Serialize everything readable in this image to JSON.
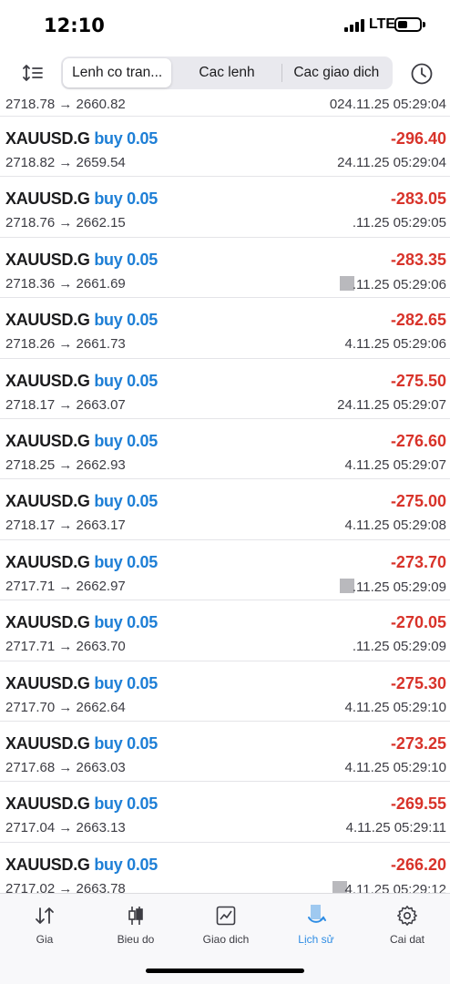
{
  "status": {
    "time": "12:10",
    "network": "LTE"
  },
  "toolbar": {
    "tabs": [
      {
        "label": "Lenh co tran..."
      },
      {
        "label": "Cac lenh"
      },
      {
        "label": "Cac giao dich"
      }
    ],
    "active_tab": 0
  },
  "first_row": {
    "prices": "2718.78 → 2660.82",
    "time": "024.11.25 05:29:04"
  },
  "trades": [
    {
      "symbol": "XAUUSD.G",
      "side": "buy 0.05",
      "profit": "-296.40",
      "prices": "2718.82 → 2659.54",
      "time": "24.11.25 05:29:04"
    },
    {
      "symbol": "XAUUSD.G",
      "side": "buy 0.05",
      "profit": "-283.05",
      "prices": "2718.76 → 2662.15",
      "time": ".11.25 05:29:05"
    },
    {
      "symbol": "XAUUSD.G",
      "side": "buy 0.05",
      "profit": "-283.35",
      "prices": "2718.36 → 2661.69",
      "time": ".11.25 05:29:06"
    },
    {
      "symbol": "XAUUSD.G",
      "side": "buy 0.05",
      "profit": "-282.65",
      "prices": "2718.26 → 2661.73",
      "time": "4.11.25 05:29:06"
    },
    {
      "symbol": "XAUUSD.G",
      "side": "buy 0.05",
      "profit": "-275.50",
      "prices": "2718.17 → 2663.07",
      "time": "24.11.25 05:29:07"
    },
    {
      "symbol": "XAUUSD.G",
      "side": "buy 0.05",
      "profit": "-276.60",
      "prices": "2718.25 → 2662.93",
      "time": "4.11.25 05:29:07"
    },
    {
      "symbol": "XAUUSD.G",
      "side": "buy 0.05",
      "profit": "-275.00",
      "prices": "2718.17 → 2663.17",
      "time": "4.11.25 05:29:08"
    },
    {
      "symbol": "XAUUSD.G",
      "side": "buy 0.05",
      "profit": "-273.70",
      "prices": "2717.71 → 2662.97",
      "time": ".11.25 05:29:09"
    },
    {
      "symbol": "XAUUSD.G",
      "side": "buy 0.05",
      "profit": "-270.05",
      "prices": "2717.71 → 2663.70",
      "time": ".11.25 05:29:09"
    },
    {
      "symbol": "XAUUSD.G",
      "side": "buy 0.05",
      "profit": "-275.30",
      "prices": "2717.70 → 2662.64",
      "time": "4.11.25 05:29:10"
    },
    {
      "symbol": "XAUUSD.G",
      "side": "buy 0.05",
      "profit": "-273.25",
      "prices": "2717.68 → 2663.03",
      "time": "4.11.25 05:29:10"
    },
    {
      "symbol": "XAUUSD.G",
      "side": "buy 0.05",
      "profit": "-269.55",
      "prices": "2717.04 → 2663.13",
      "time": "4.11.25 05:29:11"
    },
    {
      "symbol": "XAUUSD.G",
      "side": "buy 0.05",
      "profit": "-266.20",
      "prices": "2717.02 → 2663.78",
      "time": "4.11.25 05:29:12"
    }
  ],
  "blurred_rows": [
    2,
    7,
    12
  ],
  "tabbar": {
    "items": [
      {
        "label": "Gia",
        "icon": "quotes-icon"
      },
      {
        "label": "Bieu do",
        "icon": "candlestick-icon"
      },
      {
        "label": "Giao dich",
        "icon": "trade-chart-icon"
      },
      {
        "label": "Lịch sử",
        "icon": "history-icon"
      },
      {
        "label": "Cai dat",
        "icon": "settings-gear-icon"
      }
    ],
    "active": 3
  },
  "colors": {
    "accent": "#2f8de4",
    "side": "#1e7fd6",
    "loss": "#d8332a"
  }
}
